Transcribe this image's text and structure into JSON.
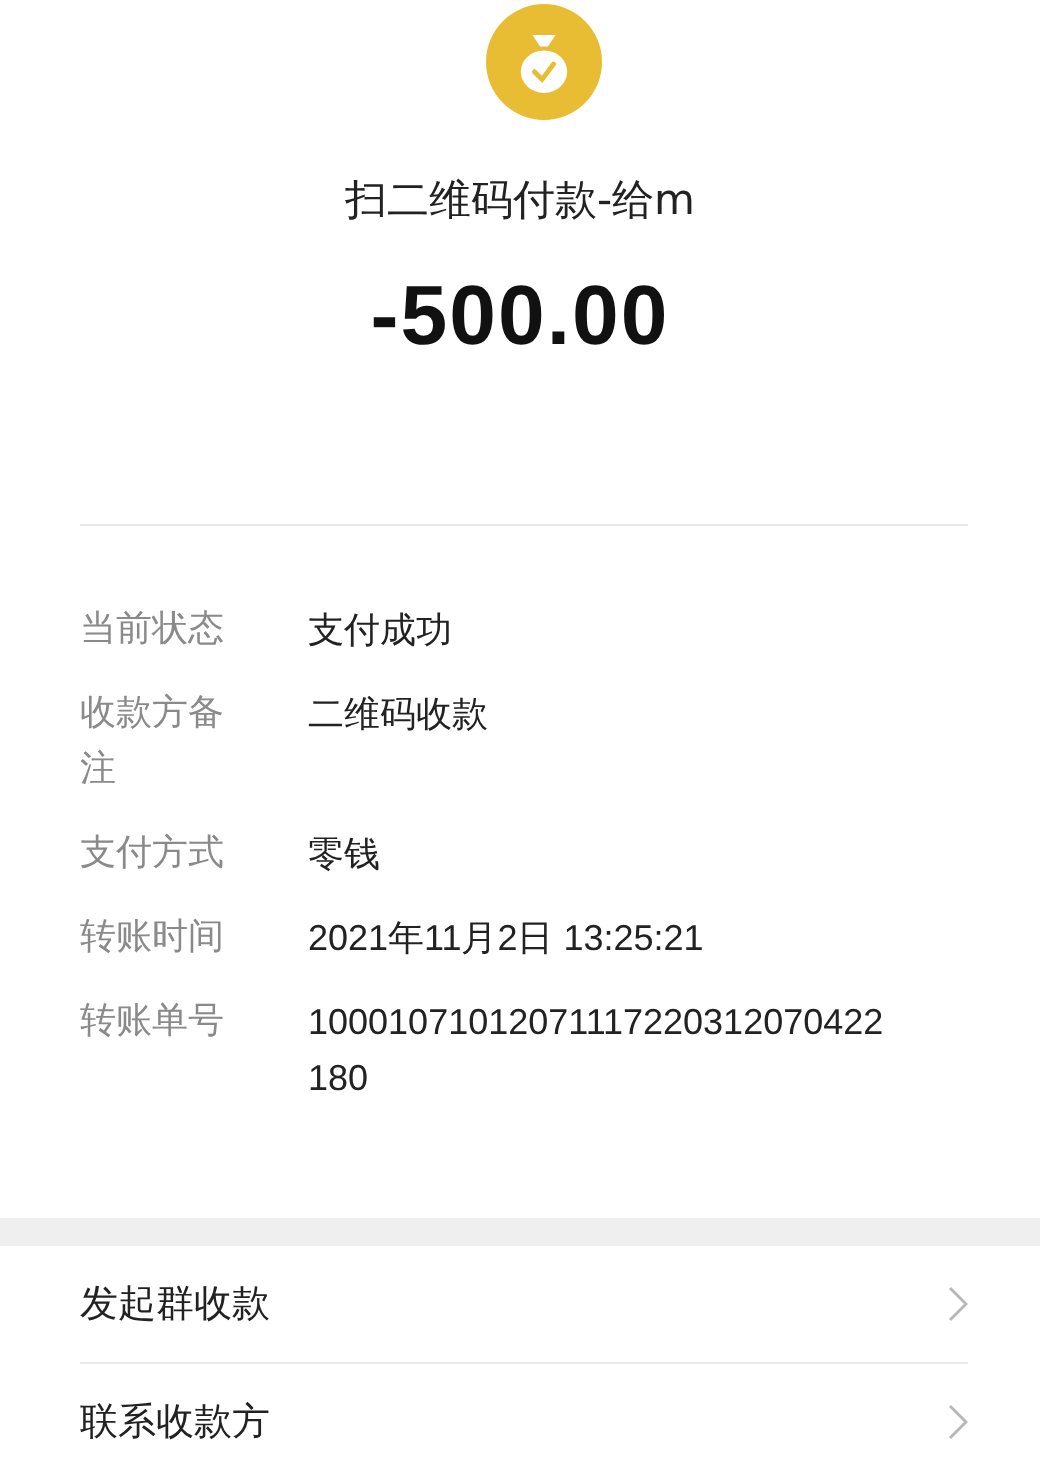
{
  "title": "扫二维码付款-给m",
  "amount": "-500.00",
  "details": [
    {
      "label": "当前状态",
      "value": "支付成功"
    },
    {
      "label": "收款方备注",
      "value": "二维码收款"
    },
    {
      "label": "支付方式",
      "value": "零钱"
    },
    {
      "label": "转账时间",
      "value": "2021年11月2日 13:25:21"
    },
    {
      "label": "转账单号",
      "value": "10001071012071117220312070422180"
    }
  ],
  "actions": [
    {
      "label": "发起群收款"
    },
    {
      "label": "联系收款方"
    }
  ]
}
